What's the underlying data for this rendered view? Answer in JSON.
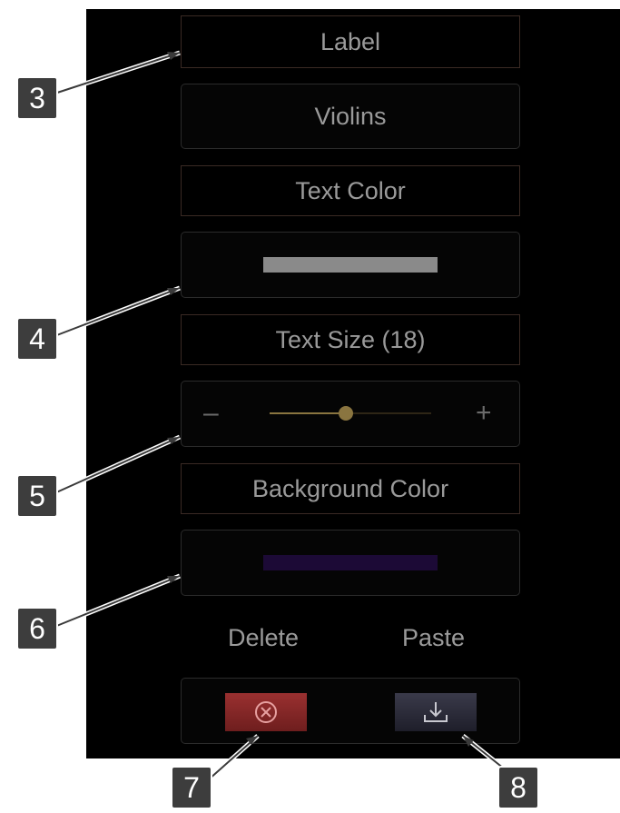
{
  "panel": {
    "label_header": "Label",
    "label_value": "Violins",
    "text_color_header": "Text Color",
    "text_color_swatch": "#8a8a8a",
    "text_size_header": "Text Size (18)",
    "text_size_slider": {
      "minus_icon": "minus-icon",
      "plus_icon": "plus-icon",
      "value": 18,
      "fraction": 0.47
    },
    "background_color_header": "Background Color",
    "background_color_swatch": "#1c0a36",
    "actions": {
      "delete_label": "Delete",
      "paste_label": "Paste",
      "delete_icon": "delete-circle-x-icon",
      "paste_icon": "paste-download-icon"
    }
  },
  "callouts": [
    "3",
    "4",
    "5",
    "6",
    "7",
    "8"
  ],
  "colors": {
    "slider_fill": "#8a7540",
    "delete_button": "#8a2a2a",
    "paste_button": "#2a2a3a"
  }
}
